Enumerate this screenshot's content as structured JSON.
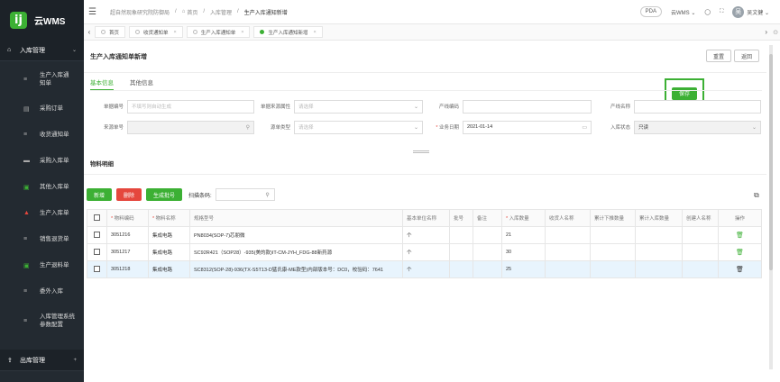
{
  "app": {
    "logo_mark": "ij",
    "name": "云WMS"
  },
  "sidebar": {
    "group_inbound": {
      "label": "入库管理",
      "arrow": "⌄"
    },
    "items": [
      {
        "label": "生产入库通知单"
      },
      {
        "label": "采购订单"
      },
      {
        "label": "收货通知单"
      },
      {
        "label": "采购入库单"
      },
      {
        "label": "其他入库单"
      },
      {
        "label": "生产入库单"
      },
      {
        "label": "销售退货单"
      },
      {
        "label": "生产退料单"
      },
      {
        "label": "委外入库"
      },
      {
        "label": "入库管理系统参数配置"
      }
    ],
    "group_outbound": {
      "label": "出库管理",
      "arrow": "+"
    }
  },
  "topbar": {
    "breadcrumb": [
      "超自然现象研究院防御局",
      "首页",
      "入库管理",
      "生产入库通知新增"
    ],
    "pda": "PDA",
    "app_switch": "云WMS ⌄",
    "user": "吴文健 ⌄",
    "avatar_char": "吴"
  },
  "tabs": [
    "首页",
    "收货通知单",
    "生产入库通知单",
    "生产入库通知新增"
  ],
  "page": {
    "title": "生产入库通知单新增",
    "save": "保存",
    "reset": "重置",
    "back": "返回"
  },
  "form_tabs": [
    "基本信息",
    "其他信息"
  ],
  "form": {
    "doc_no": {
      "label": "单据编号",
      "placeholder": "不填写则自动生成"
    },
    "source_prop": {
      "label": "单据来源属性",
      "placeholder": "请选择"
    },
    "line_code": {
      "label": "产线编码",
      "value": ""
    },
    "line_name": {
      "label": "产线名称",
      "value": ""
    },
    "source_no": {
      "label": "来源单号",
      "value": ""
    },
    "source_type": {
      "label": "源单类型",
      "placeholder": "请选择"
    },
    "biz_date": {
      "label": "业务日期",
      "value": "2021-01-14"
    },
    "in_status": {
      "label": "入库状态",
      "value": "只读"
    }
  },
  "detail": {
    "title": "物料明细",
    "add": "新增",
    "delete": "删除",
    "gen_batch": "生成批号",
    "scan_label": "扫描条码:",
    "columns": [
      "物料编码",
      "物料名称",
      "规格型号",
      "基本单位名称",
      "批号",
      "备注",
      "入库数量",
      "收货人名称",
      "累计下推数量",
      "累计入库数量",
      "创建人名称",
      "操作"
    ],
    "rows": [
      {
        "code": "3051216",
        "name": "集成电路",
        "spec": "PN8034(SOP-7)芯朋微",
        "unit": "个",
        "batch": "",
        "remark": "",
        "qty": "21"
      },
      {
        "code": "3051217",
        "name": "集成电路",
        "spec": "SC92R421（SOP28）-935(美的款)IT-CM-JYH_FDG-88新药源",
        "unit": "个",
        "batch": "",
        "remark": "",
        "qty": "30"
      },
      {
        "code": "3051218",
        "name": "集成电路",
        "spec": "SC8312(SOP-28)-936(TX-S5T13-D猛氏康-ME款型)内部版本号：DC0，校验码：7641",
        "unit": "个",
        "batch": "",
        "remark": "",
        "qty": "25"
      }
    ]
  },
  "colors": {
    "accent": "#3cb034",
    "danger": "#e5473d",
    "sidebar": "#232a31"
  }
}
